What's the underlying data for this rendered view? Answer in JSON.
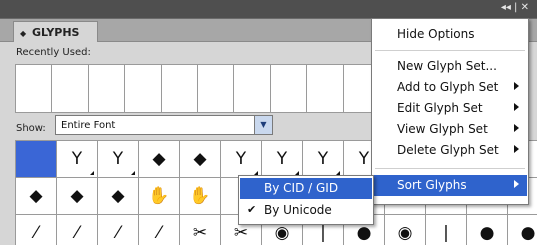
{
  "window": {
    "controls": "◂◂ | ✕"
  },
  "panel": {
    "tab_chevron": "◆",
    "tab_label": "GLYPHS",
    "recently_used_label": "Recently Used:",
    "recent_slots": 10,
    "show_label": "Show:",
    "show_value": "Entire Font"
  },
  "glyphs": [
    "",
    "Y",
    "Y",
    "◆",
    "◆",
    "Y",
    "Y",
    "Y",
    "Y",
    "",
    "",
    "",
    "",
    "◆",
    "◆",
    "◆",
    "✋",
    "✋",
    "",
    "",
    "",
    "",
    "",
    "",
    "",
    "",
    "⁄",
    "⁄",
    "⁄",
    "⁄",
    "✂",
    "✂",
    "◉",
    "|",
    "●",
    "◉",
    "|",
    "●",
    "●"
  ],
  "glyph_markers": [
    1,
    2,
    5,
    6,
    7,
    8
  ],
  "menu": {
    "items": [
      {
        "label": "Hide Options",
        "submenu": false,
        "highlighted": false
      },
      {
        "label": "New Glyph Set...",
        "submenu": false,
        "highlighted": false
      },
      {
        "label": "Add to Glyph Set",
        "submenu": true,
        "highlighted": false
      },
      {
        "label": "Edit Glyph Set",
        "submenu": true,
        "highlighted": false
      },
      {
        "label": "View Glyph Set",
        "submenu": true,
        "highlighted": false
      },
      {
        "label": "Delete Glyph Set",
        "submenu": true,
        "highlighted": false
      },
      {
        "label": "Sort Glyphs",
        "submenu": true,
        "highlighted": true
      }
    ]
  },
  "submenu": {
    "items": [
      {
        "label": "By CID / GID",
        "checked": false,
        "highlighted": true
      },
      {
        "label": "By Unicode",
        "checked": true,
        "highlighted": false
      }
    ]
  },
  "colors": {
    "selection": "#2f63cc",
    "panel_bg": "#d6d6d6",
    "window_bg": "#4d4d4d"
  }
}
